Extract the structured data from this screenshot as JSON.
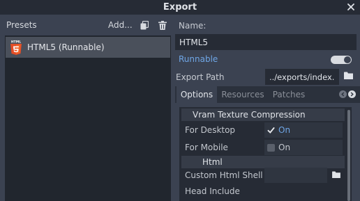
{
  "window": {
    "title": "Export"
  },
  "presets": {
    "label": "Presets",
    "add_label": "Add...",
    "items": [
      {
        "name": "HTML5 (Runnable)",
        "icon": "html5-icon",
        "icon_badge": "HTML"
      }
    ]
  },
  "form": {
    "name_label": "Name:",
    "name_value": "HTML5",
    "runnable_label": "Runnable",
    "runnable_on": true,
    "export_path_label": "Export Path",
    "export_path_value": "../exports/index."
  },
  "tabs": [
    {
      "label": "Options",
      "active": true
    },
    {
      "label": "Resources",
      "active": false
    },
    {
      "label": "Patches",
      "active": false
    }
  ],
  "options": {
    "vram_section": "Vram Texture Compression",
    "for_desktop_label": "For Desktop",
    "for_desktop_value": "On",
    "for_desktop_checked": true,
    "for_mobile_label": "For Mobile",
    "for_mobile_value": "On",
    "for_mobile_checked": false,
    "html_section": "Html",
    "custom_shell_label": "Custom Html Shell",
    "head_include_label": "Head Include"
  },
  "colors": {
    "accent": "#6fa6e6",
    "html5_orange": "#e44d26"
  }
}
